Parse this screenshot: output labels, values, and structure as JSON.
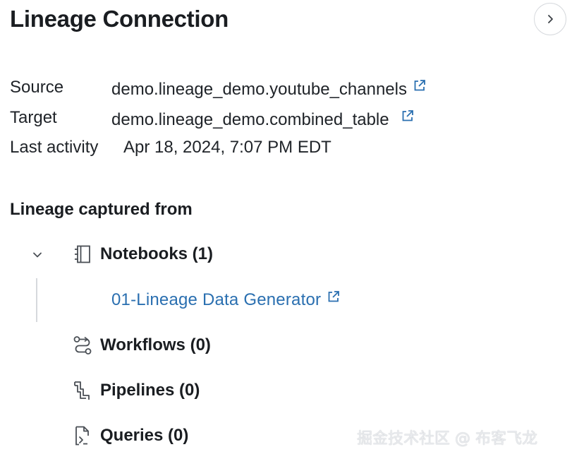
{
  "title": "Lineage Connection",
  "details": {
    "source_label": "Source",
    "source_value": "demo.lineage_demo.youtube_channels",
    "target_label": "Target",
    "target_value": "demo.lineage_demo.combined_table",
    "last_activity_label": "Last activity",
    "last_activity_value": "Apr 18, 2024, 7:07 PM EDT"
  },
  "lineage": {
    "heading": "Lineage captured from",
    "notebooks_label": "Notebooks (1)",
    "notebooks": [
      {
        "name": "01-Lineage Data Generator"
      }
    ],
    "workflows_label": "Workflows (0)",
    "pipelines_label": "Pipelines (0)",
    "queries_label": "Queries (0)"
  },
  "icons": {
    "collapse": "chevron-right-icon",
    "external_link": "external-link-icon",
    "expand": "chevron-down-icon",
    "notebook": "notebook-icon",
    "workflow": "workflow-icon",
    "pipeline": "pipeline-icon",
    "query": "query-icon"
  },
  "colors": {
    "link": "#2a6fb0",
    "text": "#1f2328",
    "divider": "#d6d9dd"
  },
  "watermark": "掘金技术社区 @ 布客飞龙"
}
